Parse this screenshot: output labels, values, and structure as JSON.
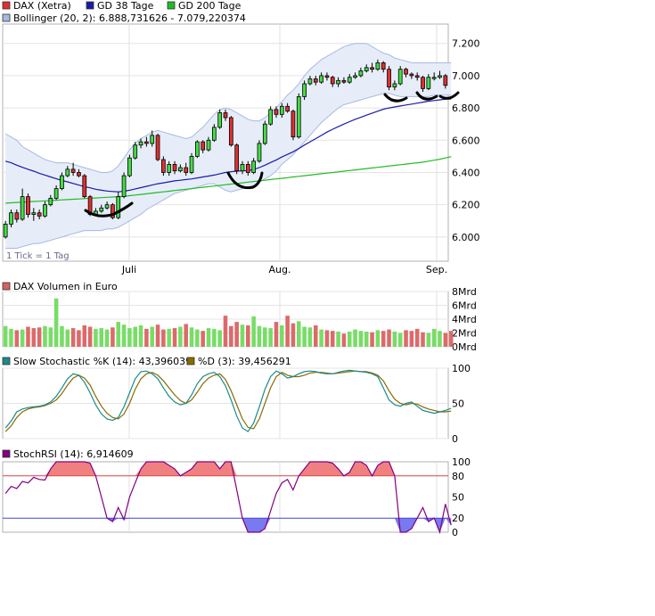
{
  "chart_data": [
    {
      "type": "candlestick",
      "panel": "price",
      "legend": [
        {
          "label": "DAX (Xetra)",
          "color": "#e03030"
        },
        {
          "label": "GD 38 Tage",
          "color": "#1a1aaa"
        },
        {
          "label": "GD 200 Tage",
          "color": "#22bb22"
        },
        {
          "label": "Bollinger (20, 2): 6.888,731626 - 7.079,220374",
          "color": "#a8b8e0"
        }
      ],
      "note": "1 Tick = 1 Tag",
      "x_labels": [
        "Juli",
        "Aug.",
        "Sep."
      ],
      "y_ticks": [
        "7.200",
        "7.000",
        "6.800",
        "6.600",
        "6.400",
        "6.200",
        "6.000"
      ],
      "y_tick_values": [
        7200,
        7000,
        6800,
        6600,
        6400,
        6200,
        6000
      ],
      "ylim": [
        5850,
        7320
      ],
      "candles": [
        [
          6000,
          6080,
          5990,
          6100
        ],
        [
          6080,
          6150,
          6060,
          6170
        ],
        [
          6150,
          6110,
          6090,
          6170
        ],
        [
          6110,
          6250,
          6100,
          6300
        ],
        [
          6250,
          6140,
          6120,
          6270
        ],
        [
          6140,
          6150,
          6100,
          6180
        ],
        [
          6150,
          6130,
          6110,
          6170
        ],
        [
          6130,
          6200,
          6120,
          6220
        ],
        [
          6200,
          6240,
          6190,
          6260
        ],
        [
          6240,
          6300,
          6230,
          6320
        ],
        [
          6300,
          6380,
          6290,
          6400
        ],
        [
          6380,
          6420,
          6370,
          6440
        ],
        [
          6420,
          6400,
          6380,
          6460
        ],
        [
          6400,
          6380,
          6370,
          6420
        ],
        [
          6380,
          6250,
          6240,
          6390
        ],
        [
          6250,
          6140,
          6130,
          6260
        ],
        [
          6140,
          6160,
          6130,
          6180
        ],
        [
          6160,
          6180,
          6150,
          6200
        ],
        [
          6180,
          6200,
          6170,
          6220
        ],
        [
          6200,
          6120,
          6110,
          6210
        ],
        [
          6120,
          6250,
          6110,
          6280
        ],
        [
          6250,
          6380,
          6240,
          6400
        ],
        [
          6380,
          6490,
          6370,
          6510
        ],
        [
          6490,
          6570,
          6480,
          6590
        ],
        [
          6570,
          6590,
          6550,
          6610
        ],
        [
          6590,
          6580,
          6560,
          6620
        ],
        [
          6580,
          6630,
          6560,
          6660
        ],
        [
          6630,
          6480,
          6470,
          6640
        ],
        [
          6480,
          6400,
          6380,
          6500
        ],
        [
          6400,
          6450,
          6380,
          6470
        ],
        [
          6450,
          6410,
          6390,
          6470
        ],
        [
          6410,
          6430,
          6400,
          6450
        ],
        [
          6430,
          6400,
          6380,
          6460
        ],
        [
          6400,
          6500,
          6390,
          6520
        ],
        [
          6500,
          6590,
          6490,
          6600
        ],
        [
          6590,
          6540,
          6520,
          6600
        ],
        [
          6540,
          6600,
          6530,
          6620
        ],
        [
          6600,
          6680,
          6590,
          6700
        ],
        [
          6680,
          6770,
          6670,
          6790
        ],
        [
          6770,
          6740,
          6720,
          6790
        ],
        [
          6740,
          6570,
          6560,
          6750
        ],
        [
          6570,
          6410,
          6390,
          6580
        ],
        [
          6410,
          6450,
          6390,
          6470
        ],
        [
          6450,
          6400,
          6380,
          6470
        ],
        [
          6400,
          6470,
          6390,
          6490
        ],
        [
          6470,
          6580,
          6460,
          6600
        ],
        [
          6580,
          6700,
          6570,
          6720
        ],
        [
          6700,
          6790,
          6690,
          6810
        ],
        [
          6790,
          6760,
          6740,
          6810
        ],
        [
          6760,
          6810,
          6740,
          6830
        ],
        [
          6810,
          6780,
          6770,
          6830
        ],
        [
          6780,
          6620,
          6600,
          6790
        ],
        [
          6620,
          6870,
          6610,
          6890
        ],
        [
          6870,
          6950,
          6850,
          6970
        ],
        [
          6950,
          6980,
          6940,
          7000
        ],
        [
          6980,
          6960,
          6940,
          7000
        ],
        [
          6960,
          7000,
          6950,
          7020
        ],
        [
          7000,
          6990,
          6970,
          7020
        ],
        [
          6990,
          6950,
          6930,
          7000
        ],
        [
          6950,
          6970,
          6930,
          6990
        ],
        [
          6970,
          6960,
          6950,
          6990
        ],
        [
          6960,
          6990,
          6950,
          7010
        ],
        [
          6990,
          7000,
          6980,
          7020
        ],
        [
          7000,
          7030,
          6990,
          7050
        ],
        [
          7030,
          7050,
          7020,
          7070
        ],
        [
          7050,
          7040,
          7020,
          7080
        ],
        [
          7040,
          7080,
          7030,
          7100
        ],
        [
          7080,
          7040,
          7020,
          7090
        ],
        [
          7040,
          6930,
          6910,
          7060
        ],
        [
          6930,
          6950,
          6910,
          6970
        ],
        [
          6950,
          7040,
          6940,
          7060
        ],
        [
          7040,
          7010,
          6990,
          7050
        ],
        [
          7010,
          7000,
          6980,
          7020
        ],
        [
          7000,
          6990,
          6970,
          7020
        ],
        [
          6990,
          6920,
          6900,
          7000
        ],
        [
          6920,
          6990,
          6910,
          7010
        ],
        [
          6990,
          6990,
          6970,
          7020
        ],
        [
          6990,
          7000,
          6980,
          7030
        ],
        [
          7000,
          6940,
          6920,
          7010
        ]
      ],
      "ma38": [
        6470,
        6460,
        6445,
        6432,
        6420,
        6408,
        6395,
        6384,
        6372,
        6362,
        6350,
        6342,
        6332,
        6322,
        6312,
        6305,
        6296,
        6290,
        6285,
        6282,
        6280,
        6284,
        6290,
        6298,
        6306,
        6314,
        6322,
        6330,
        6336,
        6342,
        6348,
        6352,
        6356,
        6360,
        6366,
        6372,
        6378,
        6384,
        6392,
        6400,
        6405,
        6408,
        6410,
        6412,
        6418,
        6430,
        6445,
        6462,
        6478,
        6496,
        6512,
        6528,
        6548,
        6570,
        6590,
        6610,
        6630,
        6650,
        6668,
        6684,
        6700,
        6715,
        6730,
        6742,
        6755,
        6768,
        6780,
        6792,
        6800,
        6806,
        6812,
        6818,
        6824,
        6830,
        6836,
        6842,
        6846,
        6850,
        6854,
        6856
      ],
      "ma200": [
        6210,
        6212,
        6214,
        6216,
        6218,
        6220,
        6222,
        6224,
        6226,
        6228,
        6230,
        6232,
        6234,
        6236,
        6238,
        6240,
        6242,
        6244,
        6246,
        6248,
        6250,
        6252,
        6256,
        6260,
        6264,
        6268,
        6272,
        6276,
        6280,
        6284,
        6288,
        6292,
        6296,
        6300,
        6304,
        6308,
        6312,
        6316,
        6320,
        6324,
        6328,
        6332,
        6336,
        6340,
        6344,
        6348,
        6352,
        6356,
        6360,
        6364,
        6368,
        6372,
        6376,
        6380,
        6384,
        6388,
        6392,
        6396,
        6400,
        6404,
        6408,
        6412,
        6416,
        6420,
        6424,
        6428,
        6432,
        6436,
        6440,
        6444,
        6448,
        6452,
        6456,
        6460,
        6464,
        6470,
        6476,
        6482,
        6490,
        6498
      ],
      "bb_upper": [
        6640,
        6620,
        6600,
        6560,
        6540,
        6520,
        6500,
        6480,
        6470,
        6460,
        6460,
        6460,
        6450,
        6440,
        6430,
        6420,
        6410,
        6400,
        6400,
        6410,
        6440,
        6490,
        6540,
        6580,
        6610,
        6630,
        6650,
        6660,
        6650,
        6640,
        6630,
        6620,
        6610,
        6620,
        6650,
        6680,
        6720,
        6760,
        6790,
        6800,
        6790,
        6770,
        6750,
        6730,
        6720,
        6720,
        6740,
        6770,
        6800,
        6840,
        6880,
        6910,
        6950,
        7000,
        7040,
        7070,
        7100,
        7120,
        7140,
        7160,
        7180,
        7190,
        7200,
        7200,
        7200,
        7180,
        7160,
        7140,
        7130,
        7110,
        7100,
        7090,
        7080,
        7080,
        7080,
        7080,
        7080,
        7080,
        7080,
        7080
      ],
      "bb_lower": [
        5930,
        5930,
        5930,
        5940,
        5950,
        5960,
        5960,
        5970,
        5980,
        5990,
        6000,
        6010,
        6020,
        6030,
        6040,
        6040,
        6040,
        6040,
        6050,
        6050,
        6060,
        6080,
        6100,
        6120,
        6140,
        6170,
        6190,
        6210,
        6230,
        6250,
        6270,
        6280,
        6290,
        6300,
        6310,
        6320,
        6330,
        6330,
        6310,
        6290,
        6280,
        6290,
        6300,
        6310,
        6320,
        6340,
        6360,
        6380,
        6410,
        6450,
        6480,
        6510,
        6550,
        6590,
        6630,
        6670,
        6710,
        6740,
        6770,
        6800,
        6820,
        6830,
        6840,
        6850,
        6860,
        6870,
        6880,
        6890,
        6890,
        6880,
        6870,
        6870,
        6870,
        6870,
        6870,
        6870,
        6880,
        6880,
        6880,
        6880
      ]
    },
    {
      "type": "bar",
      "panel": "volume",
      "legend": [
        {
          "label": "DAX Volumen in Euro",
          "color": "#d86060"
        }
      ],
      "y_ticks": [
        "8Mrd",
        "6Mrd",
        "4Mrd",
        "2Mrd",
        "0Mrd"
      ],
      "y_tick_values": [
        8,
        6,
        4,
        2,
        0
      ],
      "ylim": [
        0,
        8
      ],
      "values": [
        3.0,
        2.6,
        2.4,
        2.5,
        2.9,
        2.7,
        2.8,
        3.0,
        2.8,
        7.0,
        3.0,
        2.5,
        2.7,
        2.4,
        3.1,
        2.9,
        2.6,
        2.7,
        2.5,
        2.8,
        3.6,
        3.2,
        2.7,
        2.9,
        3.1,
        2.6,
        2.9,
        3.2,
        2.5,
        2.6,
        2.7,
        2.9,
        3.3,
        2.8,
        2.5,
        2.3,
        2.7,
        2.6,
        2.4,
        4.5,
        3.0,
        3.6,
        3.2,
        3.1,
        4.4,
        3.0,
        2.8,
        2.7,
        3.6,
        3.1,
        4.5,
        3.4,
        3.7,
        2.9,
        2.8,
        3.1,
        2.5,
        2.4,
        2.3,
        2.2,
        1.9,
        2.2,
        2.5,
        2.3,
        2.2,
        2.1,
        2.4,
        2.3,
        2.5,
        2.2,
        2.0,
        2.4,
        2.3,
        2.6,
        2.1,
        2.0,
        2.6,
        2.3,
        2.0,
        2.3
      ],
      "colors": [
        "g",
        "g",
        "r",
        "g",
        "r",
        "r",
        "r",
        "g",
        "g",
        "g",
        "g",
        "g",
        "r",
        "r",
        "r",
        "r",
        "g",
        "g",
        "g",
        "r",
        "g",
        "g",
        "g",
        "g",
        "g",
        "r",
        "g",
        "r",
        "r",
        "g",
        "r",
        "g",
        "r",
        "g",
        "g",
        "r",
        "g",
        "g",
        "g",
        "r",
        "r",
        "r",
        "g",
        "r",
        "g",
        "g",
        "g",
        "g",
        "r",
        "g",
        "r",
        "r",
        "g",
        "g",
        "g",
        "r",
        "g",
        "r",
        "r",
        "g",
        "r",
        "g",
        "g",
        "g",
        "g",
        "r",
        "g",
        "r",
        "r",
        "g",
        "g",
        "r",
        "r",
        "r",
        "r",
        "g",
        "g",
        "g",
        "r",
        "r"
      ]
    },
    {
      "type": "line",
      "panel": "stochastic",
      "legend": [
        {
          "label": "Slow Stochastic %K (14): 43,396039",
          "color": "#1a8a8a"
        },
        {
          "label": "%D (3): 39,456291",
          "color": "#8a6a00"
        }
      ],
      "y_ticks": [
        "100",
        "50",
        "0"
      ],
      "y_tick_values": [
        100,
        50,
        0
      ],
      "ylim": [
        0,
        100
      ],
      "k": [
        15,
        25,
        38,
        42,
        44,
        45,
        46,
        48,
        52,
        60,
        72,
        85,
        92,
        90,
        80,
        65,
        48,
        35,
        28,
        26,
        30,
        45,
        65,
        85,
        95,
        96,
        92,
        85,
        72,
        60,
        52,
        48,
        50,
        62,
        78,
        88,
        92,
        94,
        88,
        75,
        55,
        32,
        15,
        10,
        22,
        45,
        70,
        88,
        96,
        92,
        86,
        88,
        92,
        95,
        96,
        95,
        93,
        92,
        92,
        94,
        96,
        97,
        96,
        95,
        94,
        92,
        88,
        72,
        55,
        48,
        46,
        50,
        52,
        46,
        40,
        38,
        36,
        38,
        40,
        43
      ],
      "d": [
        10,
        18,
        30,
        38,
        42,
        44,
        45,
        47,
        50,
        55,
        64,
        76,
        86,
        90,
        86,
        76,
        60,
        46,
        36,
        30,
        28,
        35,
        50,
        70,
        85,
        92,
        94,
        90,
        82,
        72,
        62,
        54,
        50,
        55,
        66,
        78,
        86,
        90,
        92,
        84,
        68,
        48,
        28,
        16,
        14,
        28,
        50,
        72,
        88,
        94,
        90,
        88,
        88,
        90,
        93,
        94,
        94,
        93,
        92,
        93,
        94,
        95,
        96,
        95,
        95,
        93,
        90,
        82,
        68,
        56,
        50,
        48,
        50,
        49,
        45,
        42,
        40,
        38,
        38,
        39
      ]
    },
    {
      "type": "area",
      "panel": "stochrsi",
      "legend": [
        {
          "label": "StochRSI (14): 6,914609",
          "color": "#800080"
        }
      ],
      "y_ticks": [
        "100",
        "80",
        "50",
        "20",
        "0"
      ],
      "y_tick_values": [
        100,
        80,
        50,
        20,
        0
      ],
      "ylim": [
        0,
        100
      ],
      "levels": [
        80,
        20
      ],
      "level_labels": [
        "80",
        "20"
      ],
      "values": [
        55,
        65,
        62,
        72,
        70,
        78,
        75,
        74,
        90,
        100,
        100,
        100,
        100,
        100,
        100,
        98,
        80,
        50,
        20,
        15,
        35,
        18,
        50,
        70,
        90,
        100,
        100,
        100,
        100,
        95,
        90,
        80,
        85,
        90,
        100,
        100,
        100,
        100,
        90,
        100,
        100,
        60,
        20,
        0,
        0,
        0,
        5,
        30,
        55,
        70,
        75,
        60,
        80,
        90,
        100,
        100,
        100,
        100,
        98,
        90,
        80,
        85,
        100,
        100,
        95,
        80,
        95,
        100,
        100,
        80,
        0,
        0,
        5,
        20,
        35,
        15,
        20,
        0,
        40,
        10
      ]
    }
  ]
}
